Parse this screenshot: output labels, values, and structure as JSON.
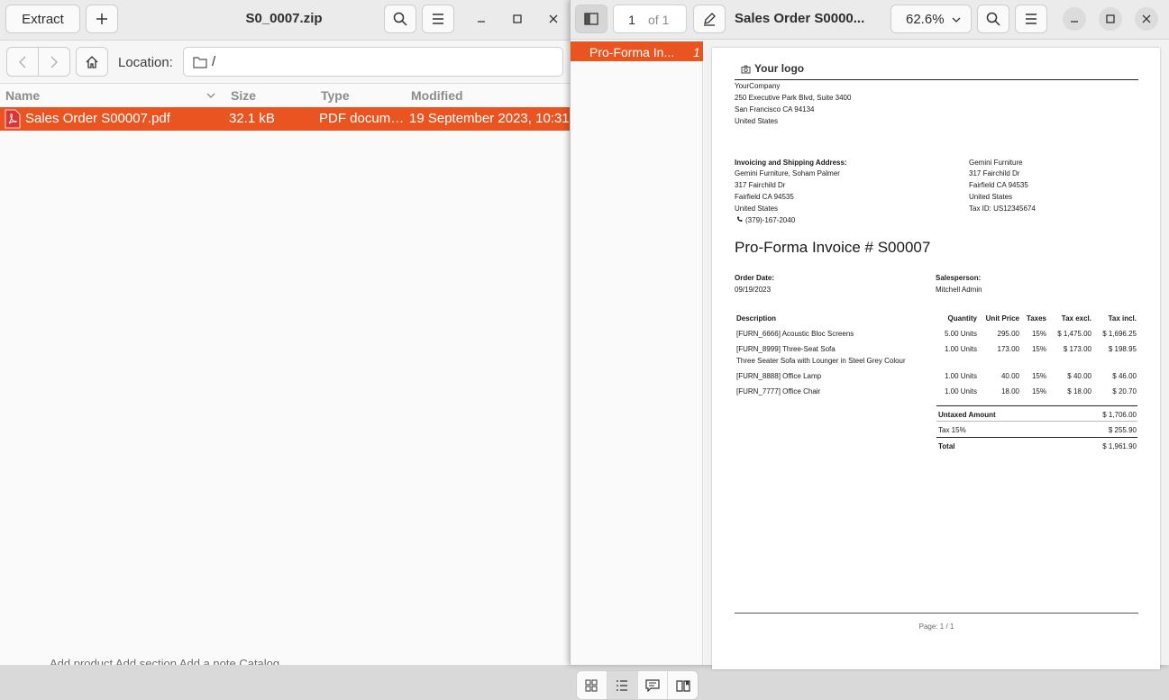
{
  "archive": {
    "title": "S0_0007.zip",
    "extract_label": "Extract",
    "location_label": "Location:",
    "location_path": "/",
    "columns": {
      "name": "Name",
      "size": "Size",
      "type": "Type",
      "modified": "Modified"
    },
    "files": [
      {
        "name": "Sales Order S00007.pdf",
        "size": "32.1 kB",
        "type": "PDF docum…",
        "modified": "19 September 2023, 10:31"
      }
    ],
    "peek_text": "Add product   Add section   Add a note   Catalog"
  },
  "viewer": {
    "title": "Sales Order S0000...",
    "page_current": "1",
    "page_of": "of 1",
    "zoom": "62.6%",
    "thumbnail_label": "Pro-Forma In...",
    "thumbnail_page": "1"
  },
  "document": {
    "logo_text": "Your logo",
    "company": [
      "YourCompany",
      "250 Executive Park Blvd, Suite 3400",
      "San Francisco CA 94134",
      "United States"
    ],
    "address_heading": "Invoicing and Shipping Address:",
    "address": [
      "Gemini Furniture, Soham Palmer",
      "317 Fairchild Dr",
      "Fairfield CA 94535",
      "United States"
    ],
    "phone": "(379)-167-2040",
    "customer": [
      "Gemini Furniture",
      "317 Fairchild Dr",
      "Fairfield CA 94535",
      "United States",
      "Tax ID: US12345674"
    ],
    "invoice_title": "Pro-Forma Invoice # S00007",
    "order_date_label": "Order Date:",
    "order_date": "09/19/2023",
    "salesperson_label": "Salesperson:",
    "salesperson": "Mitchell Admin",
    "table_headers": [
      "Description",
      "Quantity",
      "Unit Price",
      "Taxes",
      "Tax excl.",
      "Tax incl."
    ],
    "lines": [
      {
        "desc": "[FURN_6666] Acoustic Bloc Screens",
        "sub": "",
        "qty": "5.00 Units",
        "price": "295.00",
        "tax": "15%",
        "excl": "$ 1,475.00",
        "incl": "$ 1,696.25"
      },
      {
        "desc": "[FURN_8999] Three-Seat Sofa",
        "sub": "Three Seater Sofa with Lounger in Steel Grey Colour",
        "qty": "1.00 Units",
        "price": "173.00",
        "tax": "15%",
        "excl": "$ 173.00",
        "incl": "$ 198.95"
      },
      {
        "desc": "[FURN_8888] Office Lamp",
        "sub": "",
        "qty": "1.00 Units",
        "price": "40.00",
        "tax": "15%",
        "excl": "$ 40.00",
        "incl": "$ 46.00"
      },
      {
        "desc": "[FURN_7777] Office Chair",
        "sub": "",
        "qty": "1.00 Units",
        "price": "18.00",
        "tax": "15%",
        "excl": "$ 18.00",
        "incl": "$ 20.70"
      }
    ],
    "untaxed_label": "Untaxed Amount",
    "untaxed_value": "$ 1,706.00",
    "tax_label": "Tax 15%",
    "tax_value": "$ 255.90",
    "total_label": "Total",
    "total_value": "$ 1,961.90",
    "footer": "Page: 1 / 1"
  }
}
